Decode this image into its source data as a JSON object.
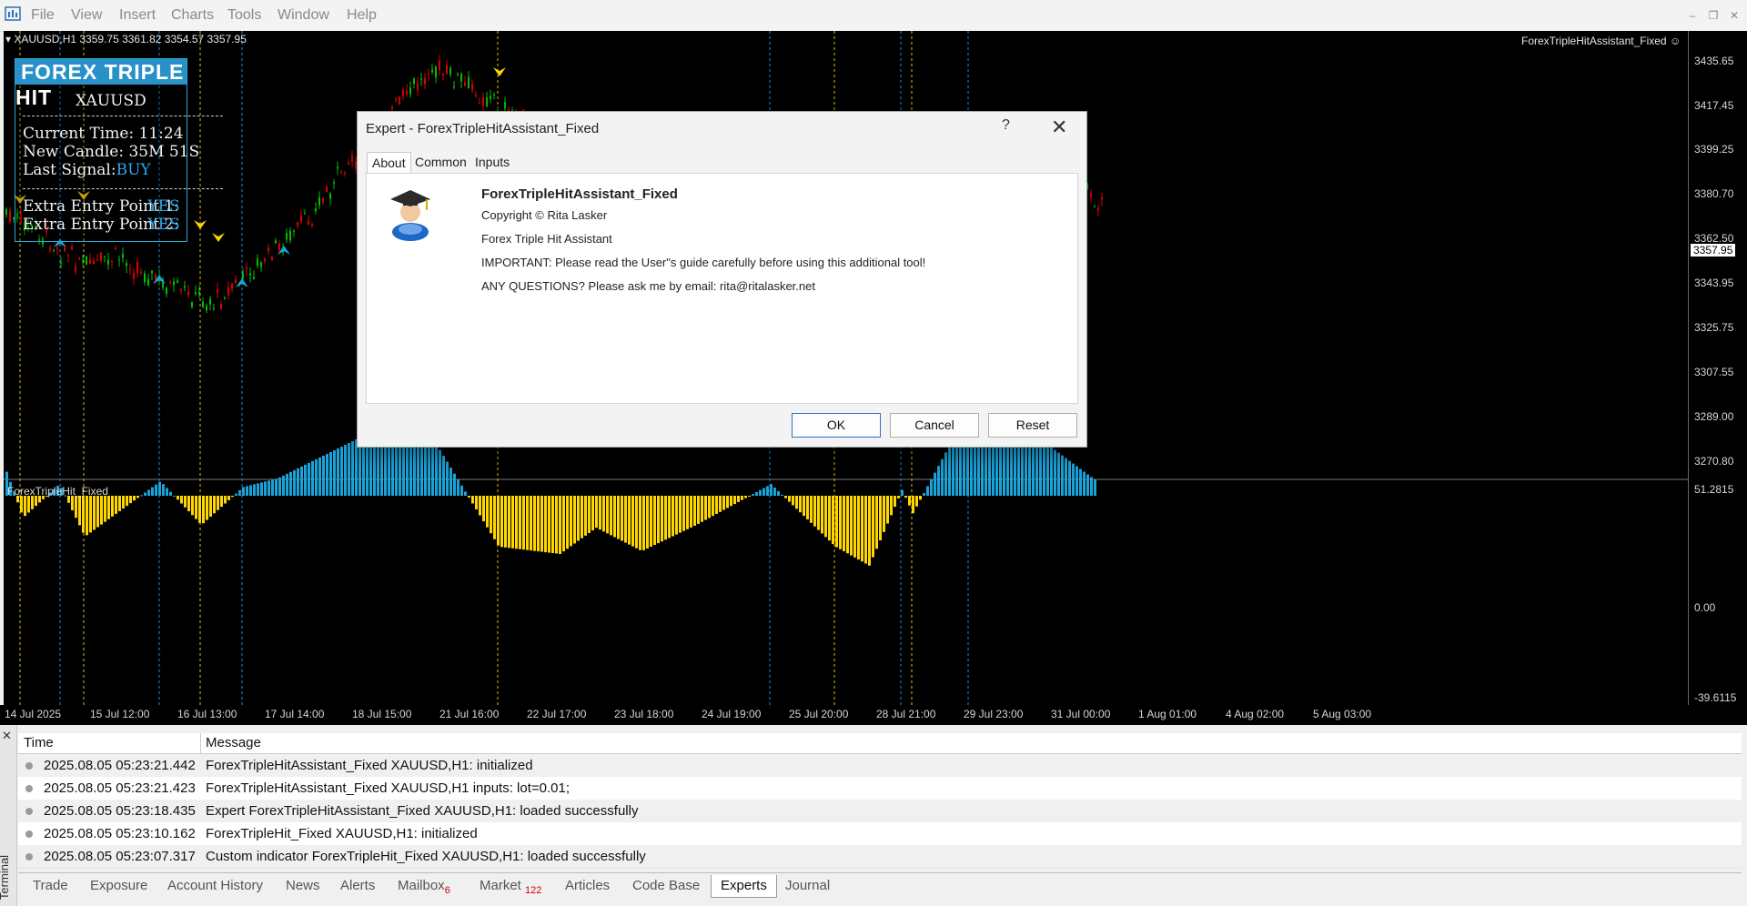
{
  "menu": {
    "items": [
      "File",
      "View",
      "Insert",
      "Charts",
      "Tools",
      "Window",
      "Help"
    ]
  },
  "chart": {
    "symbol_header": "XAUUSD,H1  3359.75 3361.82 3354.57 3357.95",
    "ea_name": "ForexTripleHitAssistant_Fixed",
    "indicator_name": "ForexTripleHit_Fixed",
    "price_labels": [
      "3435.65",
      "3417.45",
      "3399.25",
      "3380.70",
      "3362.50",
      "3343.95",
      "3325.75",
      "3307.55",
      "3289.00",
      "3270.80"
    ],
    "current_price": "3357.95",
    "osc_labels": [
      "51.2815",
      "0.00",
      "-39.6115"
    ],
    "time_labels": [
      "14 Jul 2025",
      "15 Jul 12:00",
      "16 Jul 13:00",
      "17 Jul 14:00",
      "18 Jul 15:00",
      "21 Jul 16:00",
      "22 Jul 17:00",
      "23 Jul 18:00",
      "24 Jul 19:00",
      "25 Jul 20:00",
      "28 Jul 21:00",
      "29 Jul 23:00",
      "31 Jul 00:00",
      "1 Aug 01:00",
      "4 Aug 02:00",
      "5 Aug 03:00"
    ]
  },
  "panel": {
    "title": "FOREX TRIPLE HIT",
    "symbol": "XAUUSD",
    "current_time": "Current Time: 11:24",
    "new_candle": "New Candle: 35M 51S",
    "last_signal_label": "Last Signal:",
    "last_signal_value": "BUY",
    "extra1": "Extra Entry Point 1:",
    "extra1_value": "YES",
    "extra2": "Extra Entry Point 2:",
    "extra2_value": "YES"
  },
  "dialog": {
    "title": "Expert - ForexTripleHitAssistant_Fixed",
    "help": "?",
    "close": "✕",
    "tabs": [
      "About",
      "Common",
      "Inputs"
    ],
    "name": "ForexTripleHitAssistant_Fixed",
    "copyright": "Copyright © Rita Lasker",
    "description": "Forex Triple Hit Assistant",
    "important": "IMPORTANT: Please read the User\"s guide carefully before using this additional tool!",
    "questions": "ANY QUESTIONS? Please ask me by email: rita@ritalasker.net",
    "ok": "OK",
    "cancel": "Cancel",
    "reset": "Reset"
  },
  "terminal": {
    "side_label": "Terminal",
    "col_time": "Time",
    "col_message": "Message",
    "rows": [
      {
        "time": "2025.08.05 05:23:21.442",
        "message": "ForexTripleHitAssistant_Fixed XAUUSD,H1: initialized"
      },
      {
        "time": "2025.08.05 05:23:21.423",
        "message": "ForexTripleHitAssistant_Fixed XAUUSD,H1 inputs: lot=0.01;"
      },
      {
        "time": "2025.08.05 05:23:18.435",
        "message": "Expert ForexTripleHitAssistant_Fixed XAUUSD,H1: loaded successfully"
      },
      {
        "time": "2025.08.05 05:23:10.162",
        "message": "ForexTripleHit_Fixed XAUUSD,H1: initialized"
      },
      {
        "time": "2025.08.05 05:23:07.317",
        "message": "Custom indicator ForexTripleHit_Fixed XAUUSD,H1: loaded successfully"
      }
    ],
    "tabs": [
      "Trade",
      "Exposure",
      "Account History",
      "News",
      "Alerts",
      "Mailbox",
      "Market",
      "Articles",
      "Code Base",
      "Experts",
      "Journal"
    ],
    "mailbox_count": "6",
    "market_count": "122"
  },
  "colors": {
    "bull": "#00c000",
    "bear": "#e00000",
    "osc_pos": "#1aa3d9",
    "osc_neg": "#ffd700",
    "vline_blue": "#1a8fd8",
    "vline_yellow": "#e0c000"
  }
}
